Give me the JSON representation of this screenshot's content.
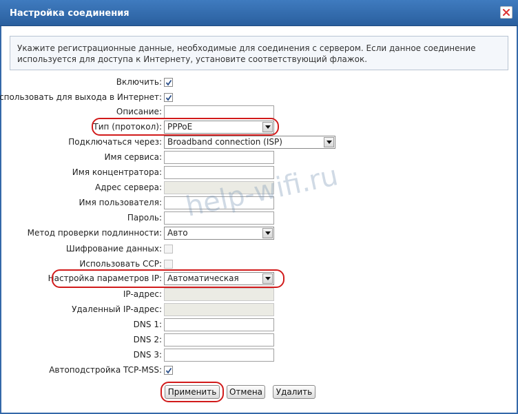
{
  "window": {
    "title": "Настройка соединения"
  },
  "info": "Укажите регистрационные данные, необходимые для соединения с сервером. Если данное соединение используется для доступа к Интернету, установите соответствующий флажок.",
  "fields": {
    "enable": {
      "label": "Включить:",
      "checked": true
    },
    "use_internet": {
      "label": "Использовать для выхода в Интернет:",
      "checked": true
    },
    "description": {
      "label": "Описание:",
      "value": ""
    },
    "protocol": {
      "label": "Тип (протокол):",
      "value": "PPPoE"
    },
    "connect_via": {
      "label": "Подключаться через:",
      "value": "Broadband connection (ISP)"
    },
    "service_name": {
      "label": "Имя сервиса:",
      "value": ""
    },
    "concentrator_name": {
      "label": "Имя концентратора:",
      "value": ""
    },
    "server_address": {
      "label": "Адрес сервера:",
      "value": ""
    },
    "username": {
      "label": "Имя пользователя:",
      "value": ""
    },
    "password": {
      "label": "Пароль:",
      "value": ""
    },
    "auth_method": {
      "label": "Метод проверки подлинности:",
      "value": "Авто"
    },
    "encryption": {
      "label": "Шифрование данных:",
      "checked": false
    },
    "use_ccp": {
      "label": "Использовать CCP:",
      "checked": false
    },
    "ip_settings": {
      "label": "Настройка параметров IP:",
      "value": "Автоматическая"
    },
    "ip_address": {
      "label": "IP-адрес:",
      "value": ""
    },
    "remote_ip": {
      "label": "Удаленный IP-адрес:",
      "value": ""
    },
    "dns1": {
      "label": "DNS 1:",
      "value": ""
    },
    "dns2": {
      "label": "DNS 2:",
      "value": ""
    },
    "dns3": {
      "label": "DNS 3:",
      "value": ""
    },
    "tcp_mss": {
      "label": "Автоподстройка TCP-MSS:",
      "checked": true
    }
  },
  "buttons": {
    "apply": "Применить",
    "cancel": "Отмена",
    "delete": "Удалить"
  },
  "watermark": "help-wifi.ru",
  "colors": {
    "titlebar": "#2f6aae",
    "highlight": "#d11a1a"
  }
}
